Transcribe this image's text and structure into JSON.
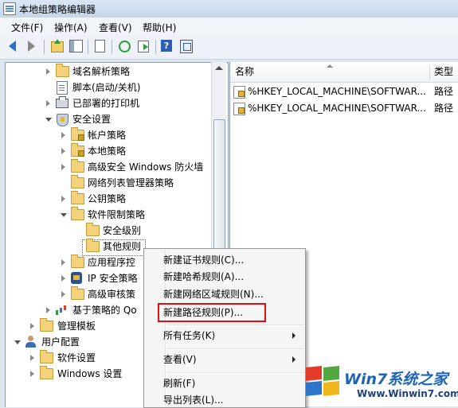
{
  "window": {
    "title": "本地组策略编辑器"
  },
  "menubar": {
    "items": [
      "文件(F)",
      "操作(A)",
      "查看(V)",
      "帮助(H)"
    ]
  },
  "toolbar": {
    "icons": [
      "back-arrow-icon",
      "forward-arrow-icon",
      "up-folder-icon",
      "show-hide-tree-icon",
      "properties-doc-icon",
      "refresh-icon",
      "export-list-icon",
      "help-icon",
      "show-action-pane-icon"
    ]
  },
  "tree": {
    "items": [
      {
        "label": "域名解析策略"
      },
      {
        "label": "脚本(启动/关机)"
      },
      {
        "label": "已部署的打印机"
      },
      {
        "label": "安全设置"
      },
      {
        "label": "帐户策略"
      },
      {
        "label": "本地策略"
      },
      {
        "label": "高级安全 Windows 防火墙"
      },
      {
        "label": "网络列表管理器策略"
      },
      {
        "label": "公钥策略"
      },
      {
        "label": "软件限制策略"
      },
      {
        "label": "安全级别"
      },
      {
        "label": "其他规则"
      },
      {
        "label": "应用程序控"
      },
      {
        "label": "IP 安全策略"
      },
      {
        "label": "高级审核策"
      },
      {
        "label": "基于策略的 Qo"
      },
      {
        "label": "管理模板"
      },
      {
        "label": "用户配置"
      },
      {
        "label": "软件设置"
      },
      {
        "label": "Windows 设置"
      }
    ]
  },
  "list": {
    "columns": [
      "名称",
      "类型"
    ],
    "rows": [
      {
        "name": "%HKEY_LOCAL_MACHINE\\SOFTWAR...",
        "type": "路径"
      },
      {
        "name": "%HKEY_LOCAL_MACHINE\\SOFTWAR...",
        "type": "路径"
      }
    ]
  },
  "context_menu": {
    "items": [
      "新建证书规则(C)...",
      "新建哈希规则(A)...",
      "新建网络区域规则(N)...",
      "新建路径规则(P)...",
      "所有任务(K)",
      "查看(V)",
      "刷新(F)",
      "导出列表(L)..."
    ],
    "highlight_color": "#e01010"
  },
  "watermark": {
    "brand": "Win7系统之家",
    "url": "Www.Winwin7.com"
  }
}
